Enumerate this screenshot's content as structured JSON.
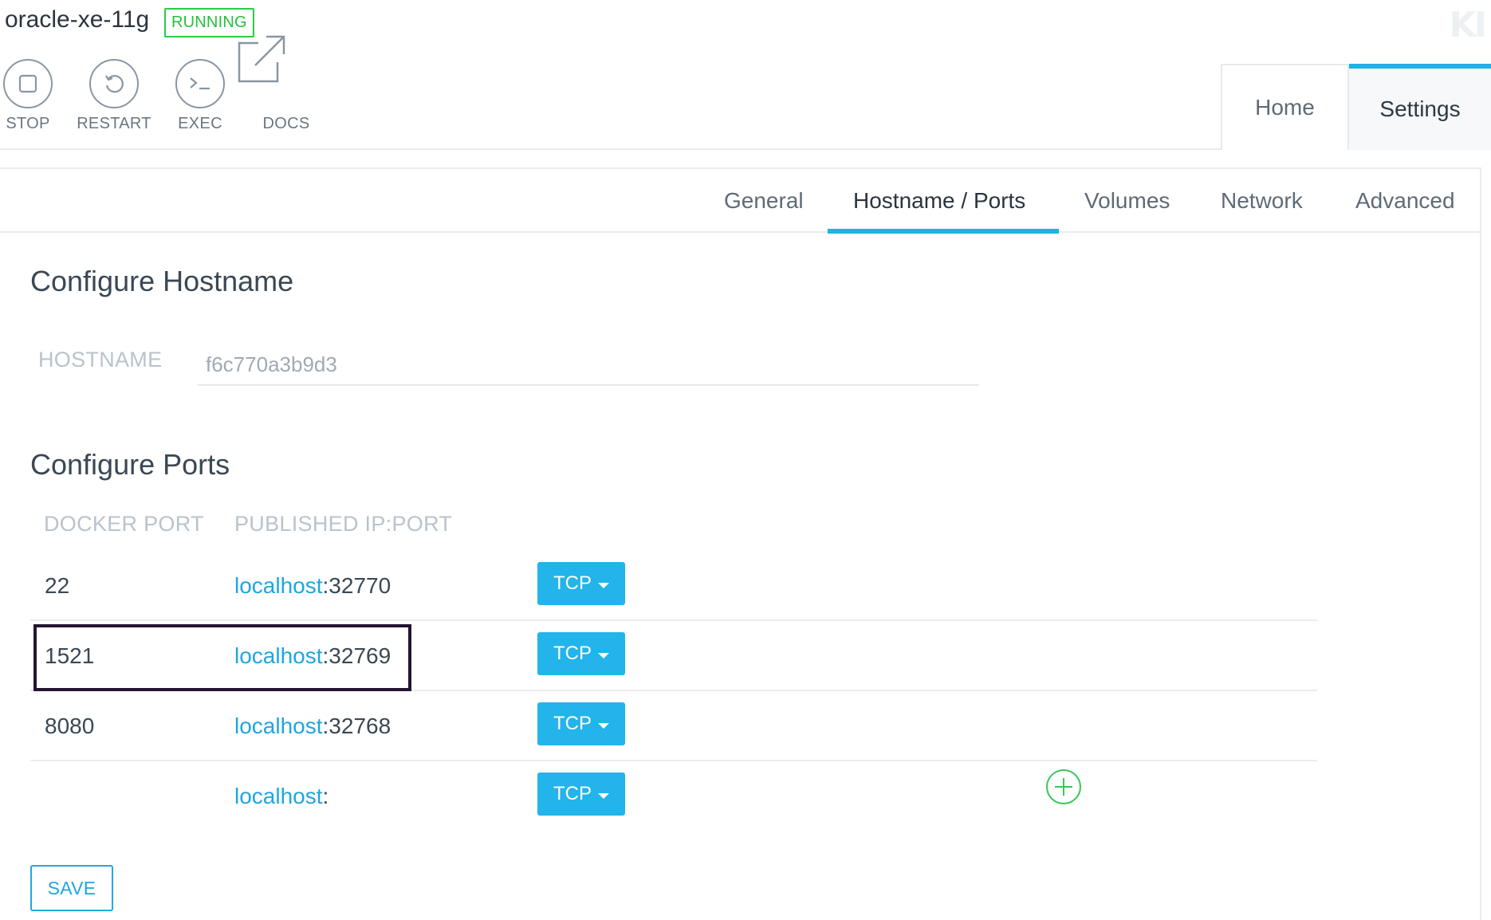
{
  "header": {
    "container_name": "oracle-xe-11g",
    "status": "RUNNING",
    "status_color": "#2bcc44",
    "brand_logo": "KI",
    "actions": [
      {
        "label": "STOP",
        "icon": "stop-icon"
      },
      {
        "label": "RESTART",
        "icon": "restart-icon"
      },
      {
        "label": "EXEC",
        "icon": "terminal-icon"
      },
      {
        "label": "DOCS",
        "icon": "external-link-icon"
      }
    ]
  },
  "top_tabs": [
    {
      "label": "Home",
      "active": false
    },
    {
      "label": "Settings",
      "active": true
    }
  ],
  "sub_tabs": [
    {
      "label": "General",
      "active": false
    },
    {
      "label": "Hostname / Ports",
      "active": true
    },
    {
      "label": "Volumes",
      "active": false
    },
    {
      "label": "Network",
      "active": false
    },
    {
      "label": "Advanced",
      "active": false
    }
  ],
  "hostname_section": {
    "title": "Configure Hostname",
    "label": "HOSTNAME",
    "value": "f6c770a3b9d3"
  },
  "ports_section": {
    "title": "Configure Ports",
    "columns": [
      "DOCKER PORT",
      "PUBLISHED IP:PORT"
    ],
    "rows": [
      {
        "docker_port": "22",
        "host": "localhost",
        "separator": ":",
        "port": "32770",
        "protocol": "TCP"
      },
      {
        "docker_port": "1521",
        "host": "localhost",
        "separator": ":",
        "port": "32769",
        "protocol": "TCP"
      },
      {
        "docker_port": "8080",
        "host": "localhost",
        "separator": ":",
        "port": "32768",
        "protocol": "TCP"
      },
      {
        "docker_port": "",
        "host": "localhost",
        "separator": ":",
        "port": "",
        "protocol": "TCP"
      }
    ]
  },
  "save_label": "SAVE",
  "colors": {
    "accent": "#1fb2e6",
    "link": "#1fa6df",
    "add": "#35c85a",
    "highlight": "#241533"
  }
}
